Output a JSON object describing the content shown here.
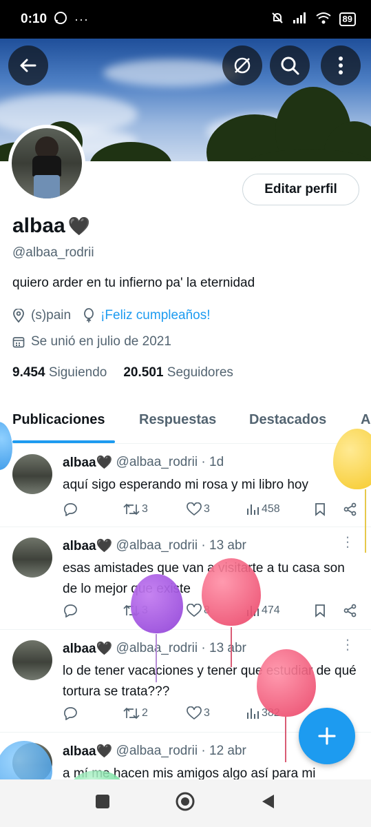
{
  "status_bar": {
    "time": "0:10",
    "battery": "89"
  },
  "header": {
    "back_label": "←",
    "icons": [
      "back-arrow-icon",
      "no-grok-icon",
      "search-icon",
      "more-vertical-icon"
    ]
  },
  "profile": {
    "name": "albaa",
    "heart": "🖤",
    "handle": "@albaa_rodrii",
    "bio": "quiero arder en tu infierno pa' la eternidad",
    "location": "(s)pain",
    "birthday": "¡Feliz cumpleaños!",
    "joined": "Se unió en julio de 2021",
    "following_count": "9.454",
    "following_label": "Siguiendo",
    "followers_count": "20.501",
    "followers_label": "Seguidores",
    "edit_button": "Editar perfil"
  },
  "tabs": [
    {
      "label": "Publicaciones",
      "active": true
    },
    {
      "label": "Respuestas",
      "active": false
    },
    {
      "label": "Destacados",
      "active": false
    },
    {
      "label": "A",
      "active": false
    }
  ],
  "tweets": [
    {
      "name": "albaa🖤",
      "handle": "@albaa_rodrii",
      "time": "· 1d",
      "text": "aquí sigo esperando mi rosa y mi libro hoy",
      "retweets": "3",
      "likes": "3",
      "views": "458"
    },
    {
      "name": "albaa🖤",
      "handle": "@albaa_rodrii",
      "time": "· 13 abr",
      "text": "esas amistades que van a visitarte a tu casa son de lo mejor que existe",
      "retweets": "3",
      "likes": "8",
      "views": "474"
    },
    {
      "name": "albaa🖤",
      "handle": "@albaa_rodrii",
      "time": "· 13 abr",
      "text": "lo de tener vacaciones y tener que estudiar de qué tortura se trata???",
      "retweets": "2",
      "likes": "3",
      "views": "382"
    },
    {
      "name": "albaa🖤",
      "handle": "@albaa_rodrii",
      "time": "· 12 abr",
      "text": "a mí me hacen mis amigos algo así para mi",
      "retweets": "",
      "likes": "",
      "views": ""
    }
  ],
  "fab_label": "+",
  "colors": {
    "accent": "#1d9bf0",
    "text": "#0f1419",
    "muted": "#536471"
  }
}
